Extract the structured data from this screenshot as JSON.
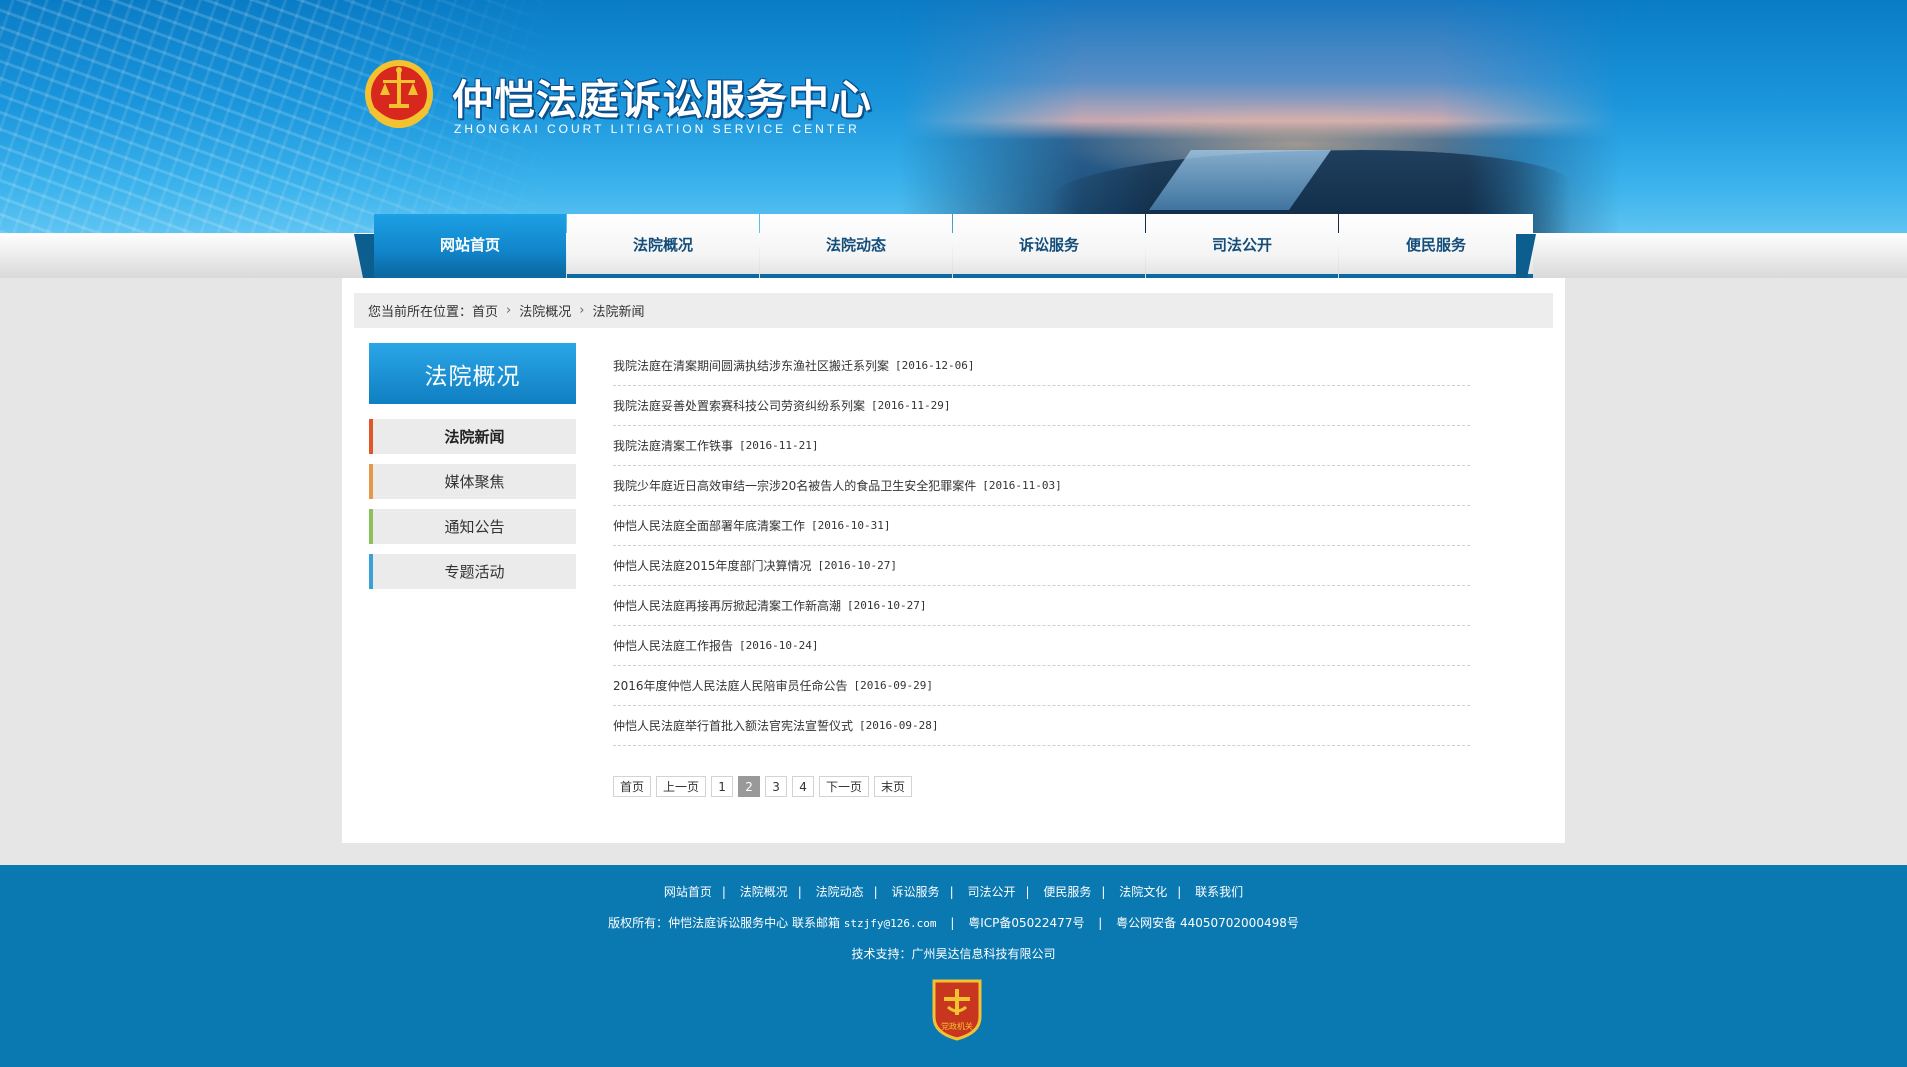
{
  "header": {
    "title": "仲恺法庭诉讼服务中心",
    "subtitle": "ZHONGKAI COURT LITIGATION SERVICE CENTER"
  },
  "nav": {
    "items": [
      "网站首页",
      "法院概况",
      "法院动态",
      "诉讼服务",
      "司法公开",
      "便民服务"
    ],
    "active": "网站首页"
  },
  "breadcrumb": {
    "prefix": "您当前所在位置：",
    "items": [
      "首页",
      "法院概况",
      "法院新闻"
    ]
  },
  "sidebar": {
    "title": "法院概况",
    "items": [
      {
        "label": "法院新闻",
        "color": "#e0552a",
        "active": true
      },
      {
        "label": "媒体聚焦",
        "color": "#e8974a",
        "active": false
      },
      {
        "label": "通知公告",
        "color": "#8cc05a",
        "active": false
      },
      {
        "label": "专题活动",
        "color": "#3aa0d8",
        "active": false
      }
    ]
  },
  "news": [
    {
      "title": "我院法庭在清案期间圆满执结涉东渔社区搬迁系列案",
      "date": "[2016-12-06]"
    },
    {
      "title": "我院法庭妥善处置索赛科技公司劳资纠纷系列案",
      "date": "[2016-11-29]"
    },
    {
      "title": "我院法庭清案工作铁事",
      "date": "[2016-11-21]"
    },
    {
      "title": "我院少年庭近日高效审结一宗涉20名被告人的食品卫生安全犯罪案件",
      "date": "[2016-11-03]"
    },
    {
      "title": "仲恺人民法庭全面部署年底清案工作",
      "date": "[2016-10-31]"
    },
    {
      "title": "仲恺人民法庭2015年度部门决算情况",
      "date": "[2016-10-27]"
    },
    {
      "title": "仲恺人民法庭再接再厉掀起清案工作新高潮",
      "date": "[2016-10-27]"
    },
    {
      "title": "仲恺人民法庭工作报告",
      "date": "[2016-10-24]"
    },
    {
      "title": "2016年度仲恺人民法庭人民陪审员任命公告",
      "date": "[2016-09-29]"
    },
    {
      "title": "仲恺人民法庭举行首批入额法官宪法宣誓仪式",
      "date": "[2016-09-28]"
    }
  ],
  "pager": {
    "first": "首页",
    "prev": "上一页",
    "pages": [
      "1",
      "2",
      "3",
      "4"
    ],
    "current": "2",
    "next": "下一页",
    "last": "末页"
  },
  "footer": {
    "links": [
      "网站首页",
      "法院概况",
      "法院动态",
      "诉讼服务",
      "司法公开",
      "便民服务",
      "法院文化",
      "联系我们"
    ],
    "copyright": "版权所有：仲恺法庭诉讼服务中心  联系邮箱",
    "email": "stzjfy@126.com",
    "icp": "粤ICP备05022477号",
    "police": "粤公网安备 44050702000498号",
    "support": "技术支持：广州昊达信息科技有限公司",
    "badge_text": "党政机关"
  },
  "colors": {
    "brand_blue": "#0a79b2",
    "nav_active": "#1186cc",
    "emblem_red": "#d8271c",
    "emblem_gold": "#f2c230"
  }
}
